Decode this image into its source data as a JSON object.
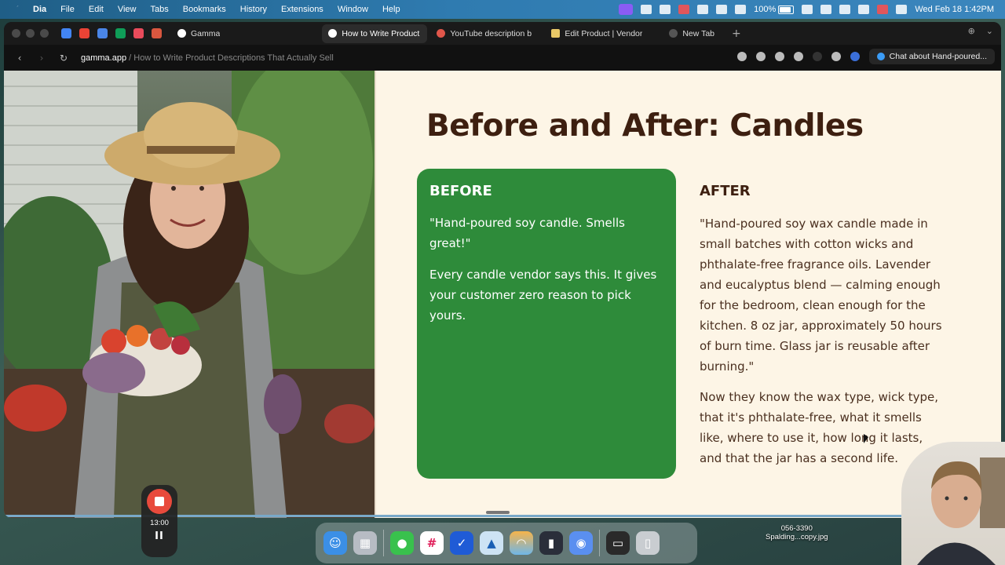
{
  "menubar": {
    "app": "Dia",
    "items": [
      "File",
      "Edit",
      "View",
      "Tabs",
      "Bookmarks",
      "History",
      "Extensions",
      "Window",
      "Help"
    ],
    "battery": "100%",
    "datetime": "Wed Feb 18  1:42PM"
  },
  "tabs": [
    {
      "label": "Gamma",
      "color": "#ffffff",
      "active": false
    },
    {
      "label": "How to Write Product D",
      "color": "#ffffff",
      "active": true
    },
    {
      "label": "YouTube description b",
      "color": "#e0564a",
      "active": false
    },
    {
      "label": "Edit Product | Vendor",
      "color": "#e8c867",
      "active": false
    },
    {
      "label": "New Tab",
      "color": "#555555",
      "active": false
    }
  ],
  "address": {
    "domain": "gamma.app",
    "path": " / How to Write Product Descriptions That Actually Sell"
  },
  "chat_button": "Chat about Hand-poured...",
  "slide": {
    "title": "Before and After: Candles",
    "before": {
      "heading": "BEFORE",
      "quote": "\"Hand-poured soy candle. Smells great!\"",
      "note": "Every candle vendor says this. It gives your customer zero reason to pick yours."
    },
    "after": {
      "heading": "AFTER",
      "quote": "\"Hand-poured soy wax candle made in small batches with cotton wicks and phthalate-free fragrance oils. Lavender and eucalyptus blend — calming enough for the bedroom, clean enough for the kitchen. 8 oz jar, approximately 50 hours of burn time. Glass jar is reusable after burning.\"",
      "note": "Now they know the wax type, wick type, that it's phthalate-free, what it smells like, where to use it, how long it lasts, and that the jar has a second life."
    }
  },
  "recorder": {
    "time": "13:00",
    "pause": "II"
  },
  "desktop_file": {
    "line1": "056-3390",
    "line2": "Spalding...copy.jpg"
  },
  "colors": {
    "before_card": "#2e8b3a",
    "title": "#3d1f10",
    "page_bg": "#fdf5e6"
  }
}
